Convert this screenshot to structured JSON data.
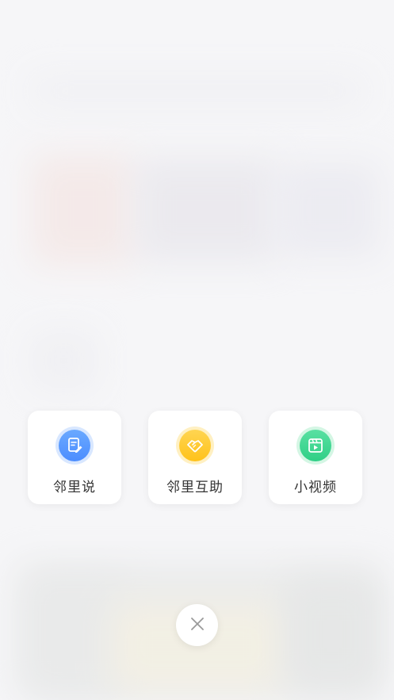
{
  "actions": [
    {
      "label": "邻里说",
      "icon": "note-edit-icon",
      "color": "#4c8dff"
    },
    {
      "label": "邻里互助",
      "icon": "handshake-icon",
      "color": "#ffc21a"
    },
    {
      "label": "小视频",
      "icon": "video-play-icon",
      "color": "#2fcf86"
    }
  ],
  "close": {
    "icon": "close-icon",
    "color": "#9a9a9a"
  }
}
